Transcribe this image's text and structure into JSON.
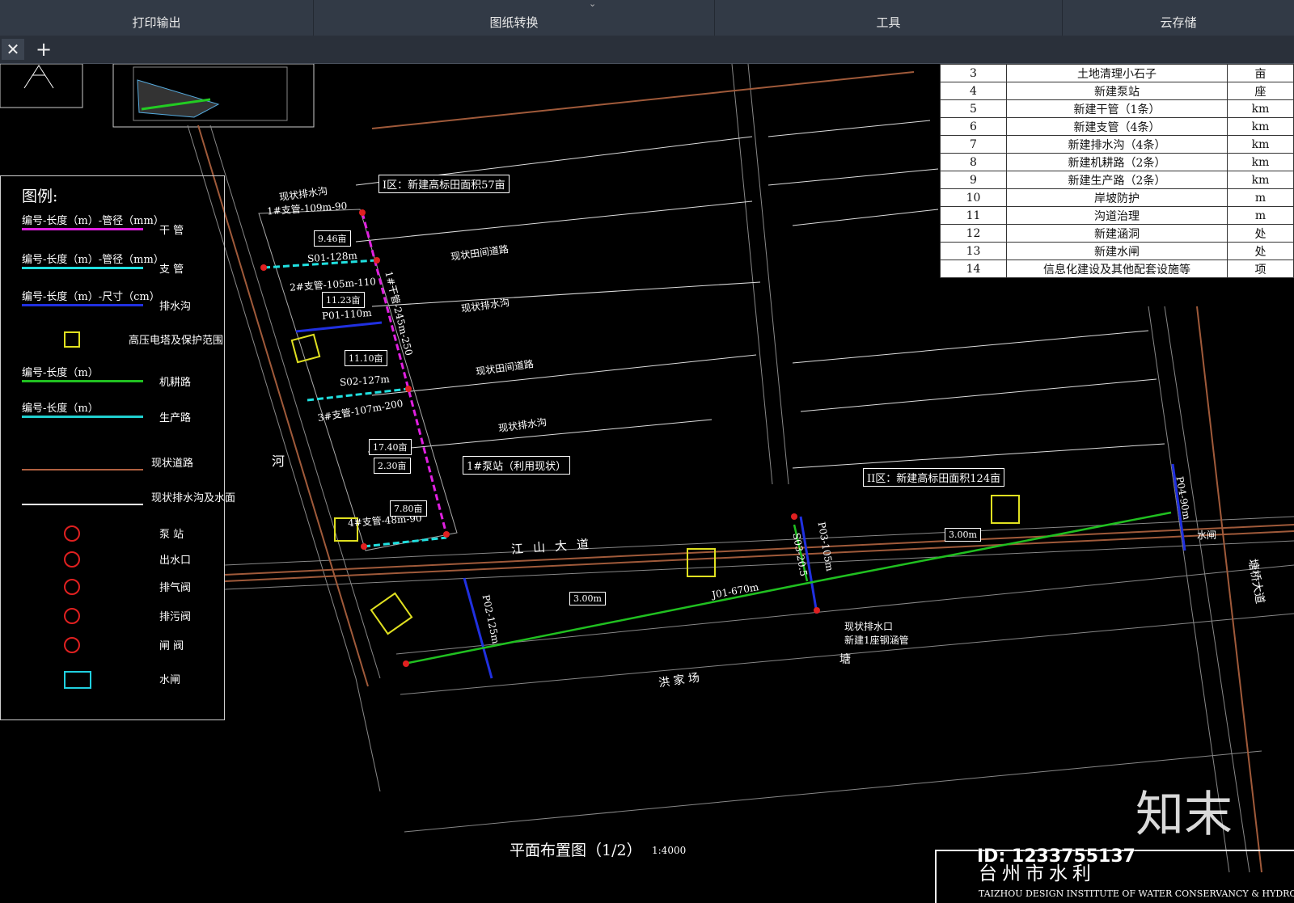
{
  "menubar": {
    "items": [
      "打印输出",
      "图纸转换",
      "工具",
      "云存储"
    ],
    "collapse_glyph": "⌄"
  },
  "tabbar": {
    "close_glyph": "✕",
    "add_glyph": "+"
  },
  "legend": {
    "title": "图例:",
    "rows": [
      {
        "sample": "编号-长度（m）-管径（mm）",
        "name": "干  管",
        "color": "#e020e0"
      },
      {
        "sample": "编号-长度（m）-管径（mm）",
        "name": "支  管",
        "color": "#20e0e0"
      },
      {
        "sample": "编号-长度（m）-尺寸（cm）",
        "name": "排水沟",
        "color": "#2030e0"
      },
      {
        "sample": "",
        "name": "高压电塔及保护范围",
        "color": "#e0e020"
      },
      {
        "sample": "编号-长度（m）",
        "name": "机耕路",
        "color": "#20c020"
      },
      {
        "sample": "编号-长度（m）",
        "name": "生产路",
        "color": "#20d0d0"
      },
      {
        "sample": "",
        "name": "现状道路",
        "color": "#b06040"
      },
      {
        "sample": "",
        "name": "现状排水沟及水面",
        "color": "#ffffff"
      },
      {
        "sample": "",
        "name": "泵  站",
        "color": "#e02020"
      },
      {
        "sample": "",
        "name": "出水口",
        "color": "#e02020"
      },
      {
        "sample": "",
        "name": "排气阀",
        "color": "#e02020"
      },
      {
        "sample": "",
        "name": "排污阀",
        "color": "#e02020"
      },
      {
        "sample": "",
        "name": "闸  阀",
        "color": "#e02020"
      },
      {
        "sample": "",
        "name": "水闸",
        "color": "#20d0e0"
      }
    ]
  },
  "table": {
    "rows": [
      {
        "no": "3",
        "item": "土地清理小石子",
        "unit": "亩"
      },
      {
        "no": "4",
        "item": "新建泵站",
        "unit": "座"
      },
      {
        "no": "5",
        "item": "新建干管（1条）",
        "unit": "km"
      },
      {
        "no": "6",
        "item": "新建支管（4条）",
        "unit": "km"
      },
      {
        "no": "7",
        "item": "新建排水沟（4条）",
        "unit": "km"
      },
      {
        "no": "8",
        "item": "新建机耕路（2条）",
        "unit": "km"
      },
      {
        "no": "9",
        "item": "新建生产路（2条）",
        "unit": "km"
      },
      {
        "no": "10",
        "item": "岸坡防护",
        "unit": "m"
      },
      {
        "no": "11",
        "item": "沟道治理",
        "unit": "m"
      },
      {
        "no": "12",
        "item": "新建涵洞",
        "unit": "处"
      },
      {
        "no": "13",
        "item": "新建水闸",
        "unit": "处"
      },
      {
        "no": "14",
        "item": "信息化建设及其他配套设施等",
        "unit": "项"
      }
    ]
  },
  "drawing": {
    "zone1": "I区：新建高标田面积57亩",
    "zone2": "II区：新建高标田面积124亩",
    "pump_station": "1#泵站（利用现状）",
    "label_drain_a": "现状排水沟",
    "label_field_road": "现状田间道路",
    "label_drain_b": "现状排水沟",
    "label_field_road2": "现状田间道路",
    "label_drain_c": "现状排水沟",
    "label_zhi1": "1#支管-109m-90",
    "label_s01": "S01-128m",
    "label_zhi2": "2#支管-105m-110",
    "label_p01": "P01-110m",
    "label_s02": "S02-127m",
    "label_zhi3": "3#支管-107m-200",
    "label_zhi4": "4#支管-48m-90",
    "label_main": "1#干管-245m-250",
    "label_a1": "9.46亩",
    "label_a2": "11.23亩",
    "label_a3": "11.10亩",
    "label_a4": "17.40亩",
    "label_a5": "2.30亩",
    "label_a6": "7.80亩",
    "label_road": "江山大道",
    "label_j01": "J01-670m",
    "label_p02": "P02-125m",
    "label_p03": "P03-105m",
    "label_p04": "P04-90m",
    "label_s03": "S03-20.5",
    "label_w1": "3.00m",
    "label_w2": "3.00m",
    "label_outlet1": "现状排水口",
    "label_outlet2": "新建1座钢涵管",
    "label_hj": "洪      家      场",
    "label_pond": "塘",
    "label_river": "河",
    "label_road2": "塘桥大道",
    "label_shui": "水闸"
  },
  "footer": {
    "plan_title": "平面布置图（1/2）",
    "plan_scale": "1:4000",
    "company": "台州市水利",
    "company_en": "TAIZHOU DESIGN INSTITUTE OF WATER CONSERVANCY & HYDRO-ELECTRIC P",
    "id_badge": "ID: 1233755137",
    "watermark": "知末"
  }
}
